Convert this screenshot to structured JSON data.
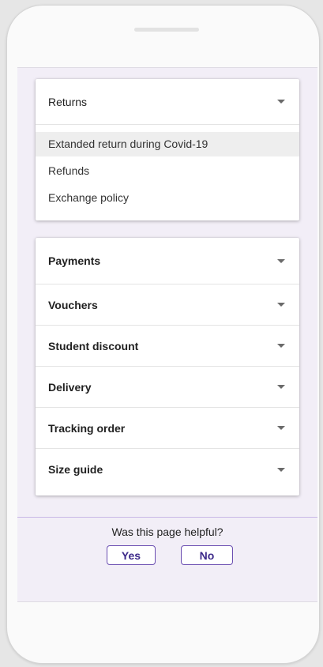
{
  "returns_section": {
    "title": "Returns",
    "items": [
      {
        "label": "Extanded return during Covid-19"
      },
      {
        "label": "Refunds"
      },
      {
        "label": "Exchange policy"
      }
    ]
  },
  "faq_sections": [
    {
      "label": "Payments"
    },
    {
      "label": "Vouchers"
    },
    {
      "label": "Student discount"
    },
    {
      "label": "Delivery"
    },
    {
      "label": "Tracking order"
    },
    {
      "label": "Size guide"
    }
  ],
  "feedback": {
    "question": "Was this page helpful?",
    "yes_label": "Yes",
    "no_label": "No"
  },
  "colors": {
    "screen_background": "#f2eef7",
    "accent": "#6a4db1",
    "button_text": "#3d2a8a"
  },
  "icons": {
    "accordion_toggle": "caret-down-icon"
  }
}
